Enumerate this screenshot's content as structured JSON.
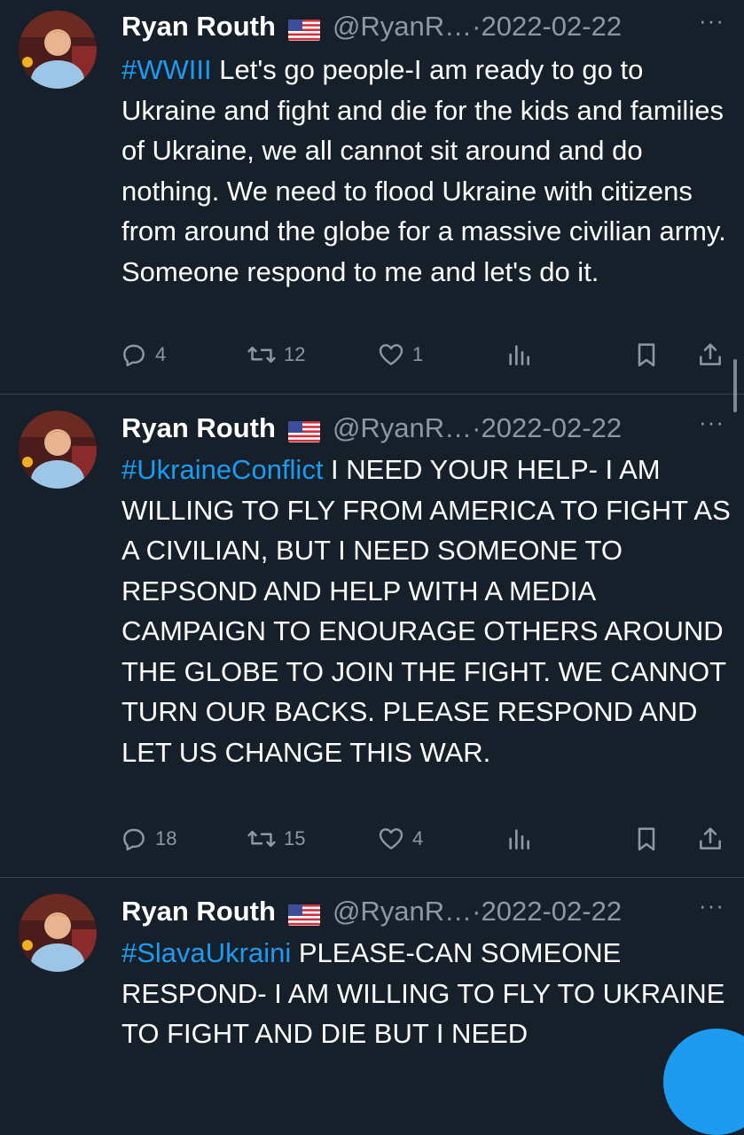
{
  "tweets": [
    {
      "author_name": "Ryan Routh",
      "flag_icon": "us-flag-icon",
      "handle": "@RyanR…",
      "separator": "·",
      "date": "2022-02-22",
      "more_label": "···",
      "hashtag": "#WWIII",
      "text": " Let's go people-I am ready to go to Ukraine and fight and die for the kids and families of Ukraine, we all cannot sit around and do nothing.  We need to flood Ukraine with citizens from around the globe for a massive civilian army. Someone respond to me and let's do it.",
      "replies": "4",
      "retweets": "12",
      "likes": "1"
    },
    {
      "author_name": "Ryan Routh",
      "flag_icon": "us-flag-icon",
      "handle": "@RyanR…",
      "separator": "·",
      "date": "2022-02-22",
      "more_label": "···",
      "hashtag": "#UkraineConflict",
      "text": " I NEED YOUR HELP- I AM WILLING TO FLY FROM AMERICA TO FIGHT AS A CIVILIAN, BUT I NEED SOMEONE TO REPSOND AND HELP WITH A MEDIA CAMPAIGN TO ENOURAGE OTHERS AROUND THE GLOBE TO JOIN THE FIGHT. WE CANNOT TURN OUR BACKS.  PLEASE RESPOND AND LET US CHANGE THIS WAR.",
      "replies": "18",
      "retweets": "15",
      "likes": "4"
    },
    {
      "author_name": "Ryan Routh",
      "flag_icon": "us-flag-icon",
      "handle": "@RyanR…",
      "separator": "·",
      "date": "2022-02-22",
      "more_label": "···",
      "hashtag": "#SlavaUkraini",
      "text": " PLEASE-CAN SOMEONE RESPOND- I AM WILLING TO FLY TO UKRAINE TO FIGHT AND DIE BUT I NEED"
    }
  ],
  "icons": {
    "reply": "reply-icon",
    "retweet": "retweet-icon",
    "like": "heart-icon",
    "views": "views-icon",
    "bookmark": "bookmark-icon",
    "share": "share-icon"
  },
  "colors": {
    "background": "#15202b",
    "text": "#ffffff",
    "secondary": "#8b98a5",
    "link": "#1d9bf0",
    "divider": "#38444d"
  }
}
